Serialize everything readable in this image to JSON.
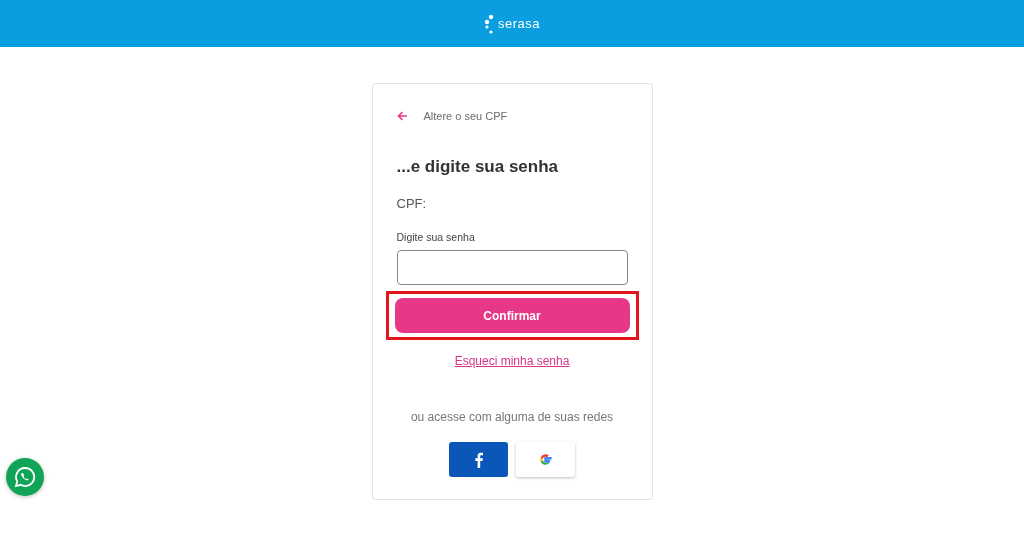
{
  "header": {
    "logo_text": "serasa"
  },
  "back_link": {
    "label": "Altere o seu CPF"
  },
  "heading": "...e digite sua senha",
  "cpf_label": "CPF:",
  "password": {
    "label": "Digite sua senha"
  },
  "confirm_button": {
    "label": "Confirmar",
    "highlighted": true
  },
  "forgot_link": "Esqueci minha senha",
  "social_text": "ou acesse com alguma de suas redes",
  "social_buttons": [
    {
      "kind": "facebook"
    },
    {
      "kind": "google"
    }
  ]
}
